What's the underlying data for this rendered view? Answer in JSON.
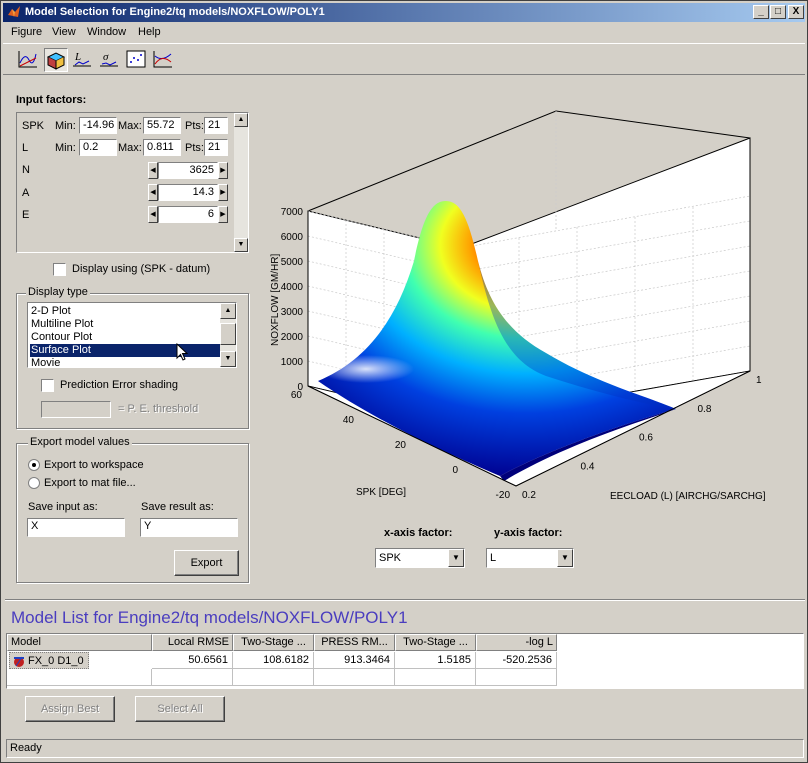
{
  "window": {
    "title": "Model Selection for Engine2/tq models/NOXFLOW/POLY1",
    "min_label": "_",
    "max_label": "□",
    "close_label": "X"
  },
  "menu": [
    "Figure",
    "View",
    "Window",
    "Help"
  ],
  "toolbar": {
    "tools": [
      "2d-plot-tool-icon",
      "surface-plot-tool-icon",
      "likelihood-plot-tool-icon",
      "residual-plot-tool-icon",
      "scatter-plot-tool-icon",
      "multiline-plot-tool-icon"
    ]
  },
  "input_factors": {
    "title": "Input factors:",
    "min_label": "Min:",
    "max_label": "Max:",
    "pts_label": "Pts:",
    "spk": {
      "name": "SPK",
      "min": "-14.96",
      "max": "55.72",
      "pts": "21"
    },
    "l": {
      "name": "L",
      "min": "0.2",
      "max": "0.811",
      "pts": "21"
    },
    "n": {
      "name": "N",
      "value": "3625"
    },
    "a": {
      "name": "A",
      "value": "14.3"
    },
    "e": {
      "name": "E",
      "value": "6"
    },
    "display_using": "Display using (SPK - datum)"
  },
  "display_type": {
    "title": "Display type",
    "items": [
      "2-D Plot",
      "Multiline Plot",
      "Contour Plot",
      "Surface Plot",
      "Movie"
    ],
    "selected": "Surface Plot",
    "prediction_error": "Prediction Error shading",
    "threshold_label": "= P. E. threshold",
    "threshold_value": ""
  },
  "export": {
    "title": "Export model values",
    "to_workspace": "Export to workspace",
    "to_mat": "Export to mat file...",
    "save_input_label": "Save input as:",
    "save_result_label": "Save result as:",
    "save_input_value": "X",
    "save_result_value": "Y",
    "export_button": "Export"
  },
  "plot": {
    "zlabel": "NOXFLOW [GM/HR]",
    "xlabel": "SPK [DEG]",
    "ylabel": "EECLOAD (L) [AIRCHG/SARCHG]",
    "z_ticks": [
      "0",
      "1000",
      "2000",
      "3000",
      "4000",
      "5000",
      "6000",
      "7000"
    ],
    "spk_ticks": [
      "60",
      "40",
      "20",
      "0",
      "-20"
    ],
    "l_ticks": [
      "0.2",
      "0.4",
      "0.6",
      "0.8",
      "1"
    ]
  },
  "chart_data": {
    "type": "surface",
    "title": "",
    "xlabel": "SPK [DEG]",
    "ylabel": "EECLOAD (L) [AIRCHG/SARCHG]",
    "zlabel": "NOXFLOW [GM/HR]",
    "xlim": [
      -20,
      60
    ],
    "ylim": [
      0.2,
      1
    ],
    "zlim": [
      0,
      7000
    ],
    "peak": {
      "x": 50,
      "y": 0.45,
      "z": 7000
    },
    "grid": true,
    "colormap": "jet"
  },
  "factors": {
    "x_label": "x-axis factor:",
    "y_label": "y-axis factor:",
    "x_value": "SPK",
    "y_value": "L"
  },
  "model_list": {
    "title": "Model List for Engine2/tq models/NOXFLOW/POLY1",
    "columns": [
      "Model",
      "Local RMSE",
      "Two-Stage ...",
      "PRESS RM...",
      "Two-Stage ...",
      "-log L"
    ],
    "rows": [
      {
        "model": "FX_0 D1_0",
        "values": [
          "50.6561",
          "108.6182",
          "913.3464",
          "1.5185",
          "-520.2536"
        ]
      }
    ],
    "assign_best": "Assign Best",
    "select_all": "Select All"
  },
  "status": "Ready"
}
